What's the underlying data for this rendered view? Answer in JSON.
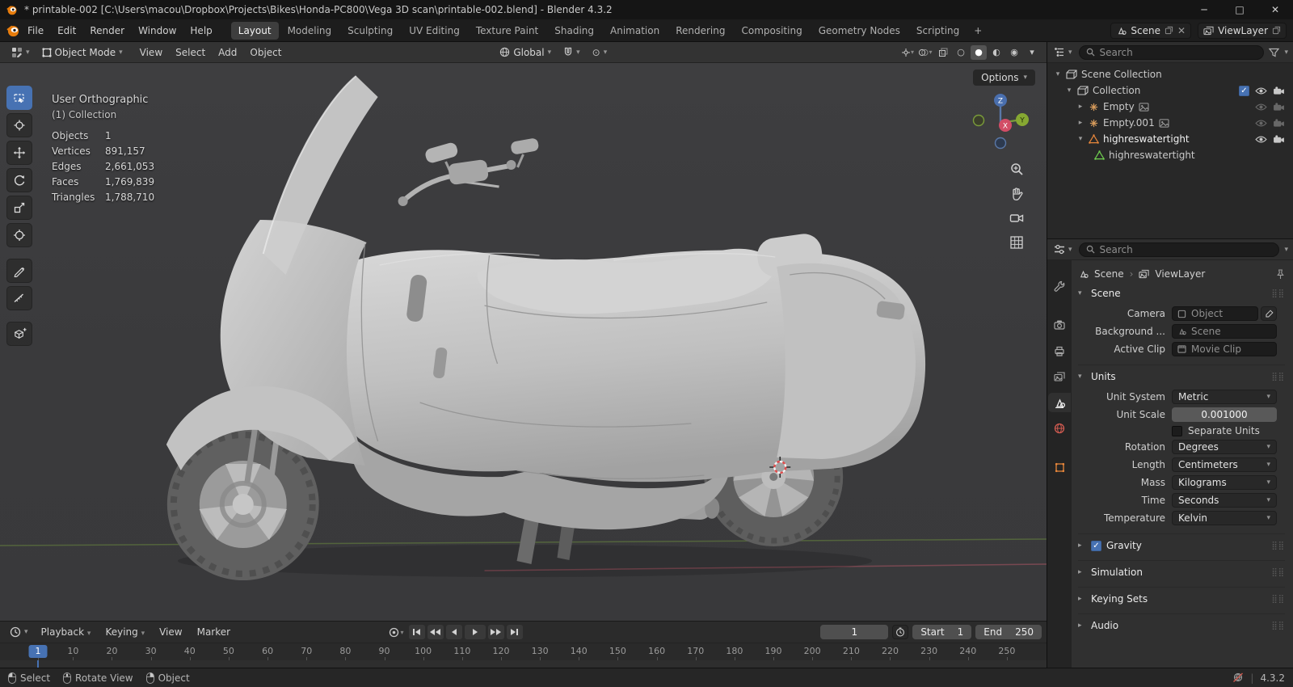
{
  "window": {
    "title": "* printable-002 [C:\\Users\\macou\\Dropbox\\Projects\\Bikes\\Honda-PC800\\Vega 3D scan\\printable-002.blend] - Blender 4.3.2",
    "controls": {
      "minimize": "─",
      "maximize": "□",
      "close": "✕"
    }
  },
  "topbar": {
    "menus": [
      "File",
      "Edit",
      "Render",
      "Window",
      "Help"
    ],
    "workspaces": [
      "Layout",
      "Modeling",
      "Sculpting",
      "UV Editing",
      "Texture Paint",
      "Shading",
      "Animation",
      "Rendering",
      "Compositing",
      "Geometry Nodes",
      "Scripting"
    ],
    "active_workspace": "Layout",
    "add_workspace": "+",
    "scene": "Scene",
    "viewlayer": "ViewLayer"
  },
  "viewport": {
    "header": {
      "mode": "Object Mode",
      "menus": [
        "View",
        "Select",
        "Add",
        "Object"
      ],
      "orientation": "Global",
      "options": "Options"
    },
    "overlay": {
      "view": "User Orthographic",
      "collection": "(1) Collection",
      "stats": [
        {
          "label": "Objects",
          "value": "1"
        },
        {
          "label": "Vertices",
          "value": "891,157"
        },
        {
          "label": "Edges",
          "value": "2,661,053"
        },
        {
          "label": "Faces",
          "value": "1,769,839"
        },
        {
          "label": "Triangles",
          "value": "1,788,710"
        }
      ]
    },
    "gizmo_axes": {
      "x": "X",
      "y": "Y",
      "z": "Z"
    },
    "side_icons": [
      "zoom-icon",
      "pan-hand-icon",
      "camera-view-icon",
      "grid-ortho-icon"
    ],
    "shading_modes": [
      "wireframe",
      "solid",
      "material-preview",
      "rendered"
    ],
    "active_shading": "solid"
  },
  "toolbar": {
    "tools": [
      "box-select",
      "cursor",
      "move",
      "rotate",
      "scale",
      "transform",
      "annotate",
      "measure",
      "add-cube"
    ],
    "active_tool": "box-select"
  },
  "outliner": {
    "search_placeholder": "Search",
    "rows": [
      {
        "label": "Scene Collection",
        "icon": "collection-icon",
        "depth": 0
      },
      {
        "label": "Collection",
        "icon": "collection-icon",
        "depth": 1
      },
      {
        "label": "Empty",
        "icon": "empty-axes-icon",
        "depth": 2
      },
      {
        "label": "Empty.001",
        "icon": "empty-axes-icon",
        "depth": 2
      },
      {
        "label": "highreswatertight",
        "icon": "mesh-object-icon",
        "depth": 2
      },
      {
        "label": "highreswatertight",
        "icon": "mesh-data-icon",
        "depth": 3
      }
    ]
  },
  "properties": {
    "search_placeholder": "Search",
    "breadcrumb": {
      "scene": "Scene",
      "viewlayer": "ViewLayer"
    },
    "tabs": [
      "tool",
      "render",
      "output",
      "view-layer",
      "scene",
      "world",
      "object"
    ],
    "active_tab": "scene",
    "scene_section": {
      "title": "Scene",
      "camera_label": "Camera",
      "camera_value": "Object",
      "background_label": "Background ...",
      "background_value": "Scene",
      "clip_label": "Active Clip",
      "clip_value": "Movie Clip"
    },
    "units_section": {
      "title": "Units",
      "unit_system_label": "Unit System",
      "unit_system": "Metric",
      "unit_scale_label": "Unit Scale",
      "unit_scale": "0.001000",
      "separate_units_label": "Separate Units",
      "rotation_label": "Rotation",
      "rotation": "Degrees",
      "length_label": "Length",
      "length": "Centimeters",
      "mass_label": "Mass",
      "mass": "Kilograms",
      "time_label": "Time",
      "time": "Seconds",
      "temperature_label": "Temperature",
      "temperature": "Kelvin"
    },
    "collapsed_sections": [
      {
        "title": "Gravity",
        "checked": true
      },
      {
        "title": "Simulation"
      },
      {
        "title": "Keying Sets"
      },
      {
        "title": "Audio"
      }
    ]
  },
  "timeline": {
    "menus": [
      "Playback",
      "Keying",
      "View",
      "Marker"
    ],
    "current_frame": "1",
    "start_label": "Start",
    "start_value": "1",
    "end_label": "End",
    "end_value": "250",
    "ticks": [
      "1",
      "10",
      "20",
      "30",
      "40",
      "50",
      "60",
      "70",
      "80",
      "90",
      "100",
      "110",
      "120",
      "130",
      "140",
      "150",
      "160",
      "170",
      "180",
      "190",
      "200",
      "210",
      "220",
      "230",
      "240",
      "250"
    ]
  },
  "statusbar": {
    "hints": [
      {
        "button": "left",
        "label": "Select"
      },
      {
        "button": "middle",
        "label": "Rotate View"
      },
      {
        "button": "right",
        "label": "Object"
      }
    ],
    "version": "4.3.2"
  }
}
